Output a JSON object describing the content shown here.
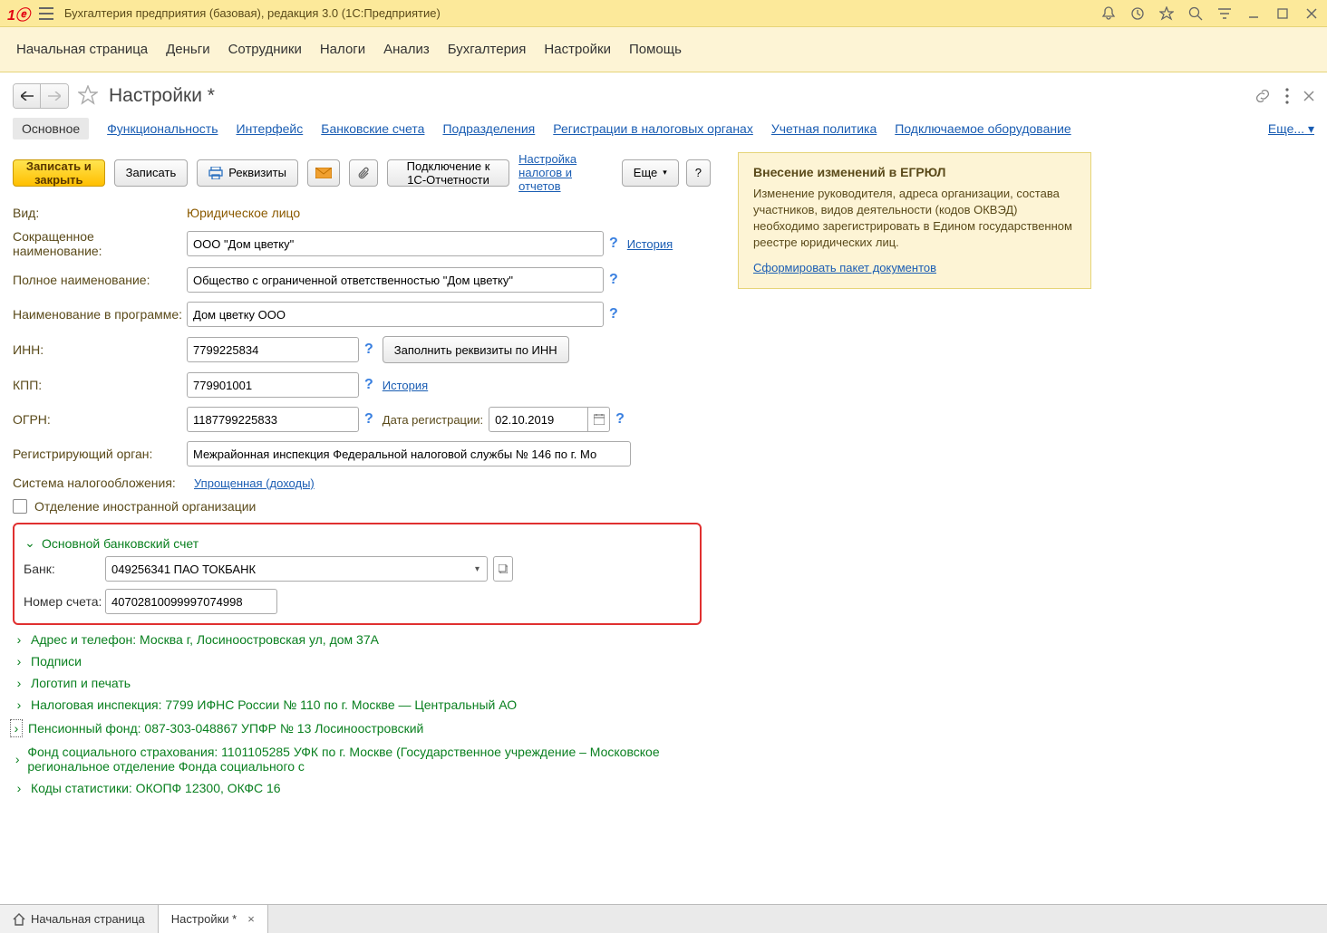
{
  "titlebar": {
    "app_title": "Бухгалтерия предприятия (базовая), редакция 3.0  (1С:Предприятие)"
  },
  "menu": {
    "items": [
      "Начальная страница",
      "Деньги",
      "Сотрудники",
      "Налоги",
      "Анализ",
      "Бухгалтерия",
      "Настройки",
      "Помощь"
    ]
  },
  "page": {
    "title": "Настройки *"
  },
  "tabs": {
    "active": "Основное",
    "items": [
      "Функциональность",
      "Интерфейс",
      "Банковские счета",
      "Подразделения",
      "Регистрации в налоговых органах",
      "Учетная политика",
      "Подключаемое оборудование"
    ],
    "more": "Еще...",
    "more_arrow": "▾"
  },
  "toolbar": {
    "save_close": "Записать и закрыть",
    "save": "Записать",
    "requisites": "Реквизиты",
    "connect_reporting": "Подключение к 1С-Отчетности",
    "tax_settings": "Настройка налогов и отчетов",
    "more": "Еще",
    "help_q": "?"
  },
  "form": {
    "type_label": "Вид:",
    "type_value": "Юридическое лицо",
    "short_name_label": "Сокращенное наименование:",
    "short_name_value": "ООО \"Дом цветку\"",
    "history": "История",
    "full_name_label": "Полное наименование:",
    "full_name_value": "Общество с ограниченной ответственностью \"Дом цветку\"",
    "prog_name_label": "Наименование в программе:",
    "prog_name_value": "Дом цветку ООО",
    "inn_label": "ИНН:",
    "inn_value": "7799225834",
    "fill_by_inn": "Заполнить реквизиты по ИНН",
    "kpp_label": "КПП:",
    "kpp_value": "779901001",
    "ogrn_label": "ОГРН:",
    "ogrn_value": "1187799225833",
    "reg_date_label": "Дата регистрации:",
    "reg_date_value": "02.10.2019",
    "reg_body_label": "Регистрирующий орган:",
    "reg_body_value": "Межрайонная инспекция Федеральной налоговой службы № 146 по г. Мо",
    "tax_system_label": "Система налогообложения:",
    "tax_system_value": "Упрощенная (доходы)",
    "foreign_branch": "Отделение иностранной организации"
  },
  "bank_section": {
    "title": "Основной банковский счет",
    "bank_label": "Банк:",
    "bank_value": "049256341 ПАО ТОКБАНК",
    "account_label": "Номер счета:",
    "account_value": "40702810099997074998"
  },
  "collapsibles": {
    "address": "Адрес и телефон: Москва г, Лосиноостровская ул, дом 37А",
    "signatures": "Подписи",
    "logo": "Логотип и печать",
    "tax_insp": "Налоговая инспекция: 7799 ИФНС России № 110 по г. Москве — Центральный АО",
    "pension": "Пенсионный фонд: 087-303-048867 УПФР № 13 Лосиноостровский",
    "social": "Фонд социального страхования: 1101105285 УФК по г. Москве (Государственное учреждение – Московское региональное отделение Фонда социального с",
    "stats": "Коды статистики: ОКОПФ 12300, ОКФС 16"
  },
  "info_panel": {
    "title": "Внесение изменений в ЕГРЮЛ",
    "body": "Изменение руководителя, адреса организации, состава участников, видов деятельности (кодов ОКВЭД) необходимо зарегистрировать в Едином государственном реестре юридических лиц.",
    "link": "Сформировать пакет документов"
  },
  "bottom_tabs": {
    "home": "Начальная страница",
    "settings": "Настройки *"
  }
}
